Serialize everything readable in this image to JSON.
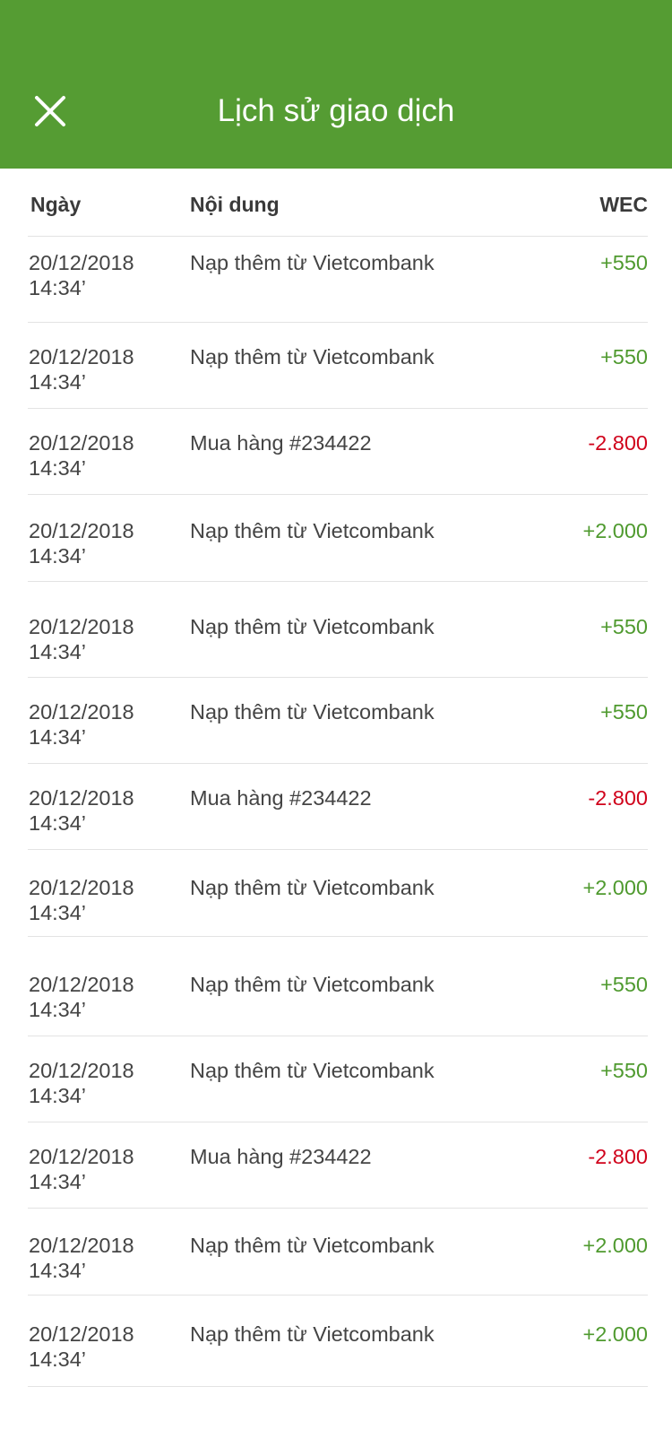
{
  "header": {
    "title": "Lịch sử giao dịch",
    "close_icon": "close-icon",
    "background": "#559c33"
  },
  "table": {
    "columns": [
      "Ngày",
      "Nội dung",
      "WEC"
    ],
    "rows": [
      {
        "date": "20/12/2018",
        "time": "14:34’",
        "content": "Nạp thêm từ Vietcombank",
        "amount": "+550",
        "type": "pos"
      },
      {
        "date": "20/12/2018",
        "time": "14:34’",
        "content": "Nạp thêm từ Vietcombank",
        "amount": "+550",
        "type": "pos"
      },
      {
        "date": "20/12/2018",
        "time": "14:34’",
        "content": "Mua hàng #234422",
        "amount": "-2.800",
        "type": "neg"
      },
      {
        "date": "20/12/2018",
        "time": "14:34’",
        "content": "Nạp thêm từ Vietcombank",
        "amount": "+2.000",
        "type": "pos"
      },
      {
        "date": "20/12/2018",
        "time": "14:34’",
        "content": "Nạp thêm từ Vietcombank",
        "amount": "+550",
        "type": "pos"
      },
      {
        "date": "20/12/2018",
        "time": "14:34’",
        "content": "Nạp thêm từ Vietcombank",
        "amount": "+550",
        "type": "pos"
      },
      {
        "date": "20/12/2018",
        "time": "14:34’",
        "content": "Mua hàng #234422",
        "amount": "-2.800",
        "type": "neg"
      },
      {
        "date": "20/12/2018",
        "time": "14:34’",
        "content": "Nạp thêm từ Vietcombank",
        "amount": "+2.000",
        "type": "pos"
      },
      {
        "date": "20/12/2018",
        "time": "14:34’",
        "content": "Nạp thêm từ Vietcombank",
        "amount": "+550",
        "type": "pos"
      },
      {
        "date": "20/12/2018",
        "time": "14:34’",
        "content": "Nạp thêm từ Vietcombank",
        "amount": "+550",
        "type": "pos"
      },
      {
        "date": "20/12/2018",
        "time": "14:34’",
        "content": "Mua hàng #234422",
        "amount": "-2.800",
        "type": "neg"
      },
      {
        "date": "20/12/2018",
        "time": "14:34’",
        "content": "Nạp thêm từ Vietcombank",
        "amount": "+2.000",
        "type": "pos"
      },
      {
        "date": "20/12/2018",
        "time": "14:34’",
        "content": "Nạp thêm từ Vietcombank",
        "amount": "+2.000",
        "type": "pos"
      }
    ]
  },
  "colors": {
    "positive": "#4f9a2f",
    "negative": "#d0021b"
  }
}
